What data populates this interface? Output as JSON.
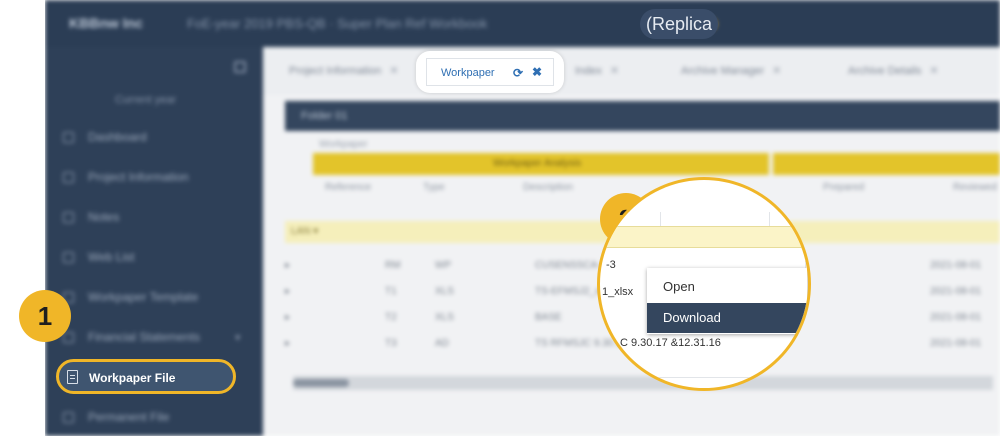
{
  "app": {
    "brand": "KBBnw Inc",
    "project": "FoE-year 2019 PBS-QB  ·  Super Plan Ref  Workbook",
    "replica_label": "(Replica"
  },
  "sidebar": {
    "heading": "Current year",
    "items": [
      {
        "label": "Dashboard"
      },
      {
        "label": "Project Information"
      },
      {
        "label": "Notes"
      },
      {
        "label": "Web List"
      },
      {
        "label": "Workpaper Template"
      },
      {
        "label": "Financial Statements"
      }
    ],
    "active_item": "Workpaper File",
    "last_item": "Permanent File"
  },
  "content": {
    "tabs": [
      {
        "label": "Project Information"
      },
      {
        "label": "Index"
      },
      {
        "label": "Archive Manager"
      },
      {
        "label": "Archive Details"
      }
    ],
    "panel_title": "Folder 01",
    "small_label": "Workpaper",
    "section_header": "Workpaper Analysis",
    "column_headers": [
      "Reference",
      "Type",
      "Description",
      "Prepared",
      "Reviewed"
    ],
    "group_label": "LAN  ▾",
    "rows": [
      {
        "ref": "RM",
        "type": "WP",
        "desc": "CUSENSSCA-3",
        "date": "2021-08-01"
      },
      {
        "ref": "T1",
        "type": "XLS",
        "desc": "TS-EFMSJ2_xlsx",
        "date": "2021-08-01"
      },
      {
        "ref": "T2",
        "type": "XLS",
        "desc": "BASE",
        "date": "2021-08-01"
      },
      {
        "ref": "T3",
        "type": "AD",
        "desc": "TS RFMSJC 9.30.17",
        "date": "2021-08-01"
      }
    ]
  },
  "tab_callout": {
    "label": "Workpaper"
  },
  "steps": {
    "one": "1",
    "two": "2"
  },
  "magnifier": {
    "frag_a": "-3",
    "frag_b": "1_xlsx",
    "frag_c": "C 9.30.17 &12.31.16",
    "menu": {
      "open": "Open",
      "download": "Download"
    }
  }
}
